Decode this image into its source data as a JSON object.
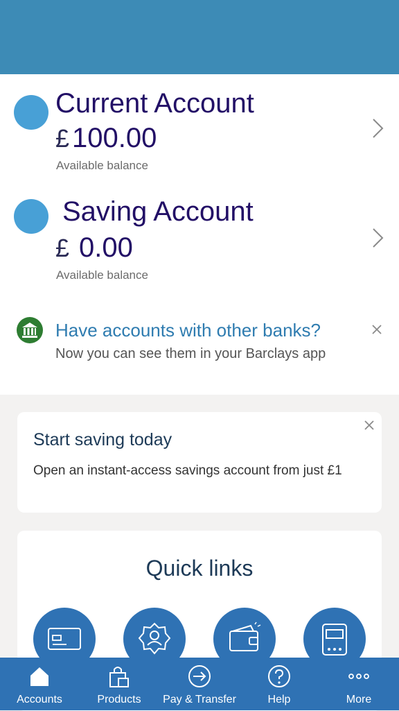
{
  "accounts": [
    {
      "name": "Current Account",
      "currency_symbol": "£",
      "amount": "100.00",
      "balance_label": "Available balance"
    },
    {
      "name": "Saving Account",
      "currency_symbol": "£",
      "amount": "0.00",
      "balance_label": "Available balance"
    }
  ],
  "other_banks": {
    "title": "Have accounts with other banks?",
    "subtitle": "Now you can see them in your Barclays app",
    "icon": "bank-icon"
  },
  "saving_promo": {
    "title": "Start saving today",
    "text": "Open an instant-access savings account from just £1"
  },
  "quick_links": {
    "title": "Quick links",
    "items": [
      {
        "icon": "card-icon"
      },
      {
        "icon": "user-gear-icon"
      },
      {
        "icon": "wallet-icon"
      },
      {
        "icon": "card-reader-icon"
      }
    ]
  },
  "tabbar": {
    "items": [
      {
        "label": "Accounts",
        "icon": "home-icon"
      },
      {
        "label": "Products",
        "icon": "shopping-bag-icon"
      },
      {
        "label": "Pay & Transfer",
        "icon": "arrow-circle-icon"
      },
      {
        "label": "Help",
        "icon": "help-icon"
      },
      {
        "label": "More",
        "icon": "more-dots-icon"
      }
    ]
  },
  "colors": {
    "header": "#3d8bb6",
    "account_dot": "#48a0d6",
    "account_text": "#220f66",
    "link_blue": "#2f7cb0",
    "tabbar": "#2f72b4",
    "bank_icon": "#2e7d32"
  }
}
